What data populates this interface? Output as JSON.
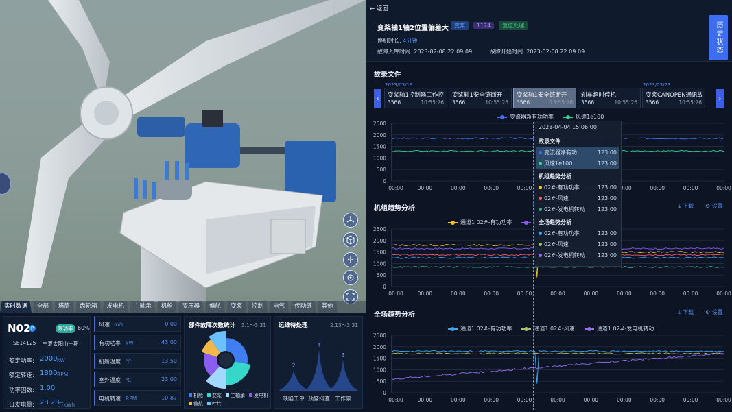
{
  "tabs": [
    "实时数据",
    "全部",
    "塔筒",
    "齿轮箱",
    "发电机",
    "主轴承",
    "机舱",
    "变压器",
    "偏航",
    "变桨",
    "控制",
    "电气",
    "传动链",
    "其他"
  ],
  "turbine": {
    "id": "N02",
    "status": "限功率",
    "percent": "60%",
    "model": "SE14125",
    "farm": "宁夏太阳山一期",
    "rated_power_label": "额定功率:",
    "rated_power": "2000",
    "rated_power_unit": "kW",
    "rated_speed_label": "额定转速:",
    "rated_speed": "1800",
    "rated_speed_unit": "RPM",
    "power_factor_label": "功率因数:",
    "power_factor": "1.00",
    "daily_energy_label": "日发电量:",
    "daily_energy": "23.23",
    "daily_energy_unit": "万kWh"
  },
  "metrics": [
    {
      "label": "风速",
      "unit": "m/s",
      "value": "0.00"
    },
    {
      "label": "有功功率",
      "unit": "kW",
      "value": "43.00"
    },
    {
      "label": "机舱温度",
      "unit": "℃",
      "value": "13.50"
    },
    {
      "label": "室外温度",
      "unit": "℃",
      "value": "23.00"
    },
    {
      "label": "电机转速",
      "unit": "RPM",
      "value": "10.87"
    }
  ],
  "fault_stats": {
    "title": "部件故障次数统计",
    "range": "3.1～3.31",
    "legend": [
      "机舱",
      "变桨",
      "主轴承",
      "发电机",
      "偏航",
      "叶片"
    ],
    "colors": [
      "#3f7df0",
      "#36d6c8",
      "#a2d7ff",
      "#8a5cf0",
      "#f0b84a",
      "#6bc1ff"
    ],
    "shares": [
      0.28,
      0.22,
      0.12,
      0.18,
      0.1,
      0.1
    ]
  },
  "maintenance": {
    "title": "运维待处理",
    "range": "2.13～3.31",
    "chart_data": {
      "type": "area",
      "categories": [
        "缺陷工单",
        "预警排查",
        "工作票"
      ],
      "values": [
        2,
        4,
        3
      ]
    }
  },
  "right": {
    "back": "返回",
    "title": "变桨轴1轴2位置偏差大",
    "badges": [
      "变桨",
      "1124",
      "复位处理"
    ],
    "downtime_label": "停机时长:",
    "downtime": "4分钟",
    "warehouse_time_label": "故障入库时间:",
    "warehouse_time": "2023-02-08 22:09:09",
    "start_time_label": "故障开始时间:",
    "start_time": "2023-02-08 22:09:09",
    "history_btn": "历史状态",
    "recorder_title": "故录文件",
    "file_dates": [
      "2023/03/19",
      "2023/03/23"
    ],
    "files": [
      {
        "name": "变桨轴1控制器工作控...",
        "code": "3566",
        "time": "10:55:26"
      },
      {
        "name": "变桨轴1安全链断开",
        "code": "3566",
        "time": "10:55:26"
      },
      {
        "name": "变桨轴1安全链断开",
        "code": "3566",
        "time": "13:55:26"
      },
      {
        "name": "刹车超时停机",
        "code": "3566",
        "time": "10:55:26"
      },
      {
        "name": "变桨CANOPEN通讯故...",
        "code": "3566",
        "time": "10:55:26"
      }
    ],
    "unit_trend_title": "机组趋势分析",
    "farm_trend_title": "全场趋势分析",
    "download": "下载",
    "settings": "设置"
  },
  "chart_data": [
    {
      "type": "line",
      "series": [
        {
          "name": "变流器净有功功率",
          "color": "#3f6ef0"
        },
        {
          "name": "风速1e100",
          "color": "#37d48f"
        }
      ],
      "yticks": [
        "2500",
        "2000",
        "1500",
        "1000",
        "500",
        "0"
      ],
      "xticks": [
        "00:00",
        "00:00",
        "00:00",
        "00:00",
        "00:00",
        "00:00",
        "00:00",
        "00:00",
        "00:00",
        "00:00",
        "00:00"
      ],
      "ylim": [
        0,
        2500
      ]
    },
    {
      "type": "line",
      "series": [
        {
          "name": "通道1 02#-有功功率",
          "color": "#f0c42a"
        },
        {
          "name": "",
          "color": "#f05a6e"
        },
        {
          "name": "",
          "color": "#4a9cf0"
        },
        {
          "name": "",
          "color": "#37a88a"
        },
        {
          "name": "发电机转动",
          "color": "#8a5cf0"
        }
      ],
      "yticks": [
        "2500",
        "2000",
        "1500",
        "1000",
        "500",
        "0"
      ],
      "xticks": [
        "00:00",
        "00:00",
        "00:00",
        "00:00",
        "00:00",
        "00:00",
        "00:00",
        "00:00",
        "00:00",
        "00:00",
        "00:00"
      ],
      "ylim": [
        0,
        2500
      ]
    },
    {
      "type": "line",
      "series": [
        {
          "name": "通道1 02#-有功功率",
          "color": "#3fa8f0"
        },
        {
          "name": "通道1 02#-风速",
          "color": "#a8c06a"
        },
        {
          "name": "通道1 02#-发电机转动",
          "color": "#9a6cf0"
        }
      ],
      "yticks": [
        "2500",
        "2000",
        "1500",
        "1000",
        "500",
        "0"
      ],
      "xticks": [
        "00:00",
        "00:00",
        "00:00",
        "00:00",
        "00:00",
        "00:00",
        "00:00",
        "00:00",
        "00:00",
        "00:00",
        "00:00"
      ],
      "ylim": [
        0,
        2500
      ]
    }
  ],
  "tooltip": {
    "time": "2023-04-04  15:06:00",
    "groups": [
      {
        "title": "故录文件",
        "rows": [
          {
            "name": "变流器净有功",
            "value": "123.00",
            "color": "#3f6ef0"
          },
          {
            "name": "风速1e100",
            "value": "123.00",
            "color": "#37d48f"
          }
        ]
      },
      {
        "title": "机组趋势分析",
        "rows": [
          {
            "name": "02#-有功功率",
            "value": "123.00",
            "color": "#f0c42a"
          },
          {
            "name": "02#-风速",
            "value": "123.00",
            "color": "#f05a6e"
          },
          {
            "name": "02#-发电机转动",
            "value": "123.00",
            "color": "#37a88a"
          }
        ]
      },
      {
        "title": "全场趋势分析",
        "rows": [
          {
            "name": "02#-有功功率",
            "value": "123.00",
            "color": "#3fa8f0"
          },
          {
            "name": "02#-风速",
            "value": "123.00",
            "color": "#a8c06a"
          },
          {
            "name": "02#-发电机转动",
            "value": "123.00",
            "color": "#9a6cf0"
          }
        ]
      }
    ]
  }
}
